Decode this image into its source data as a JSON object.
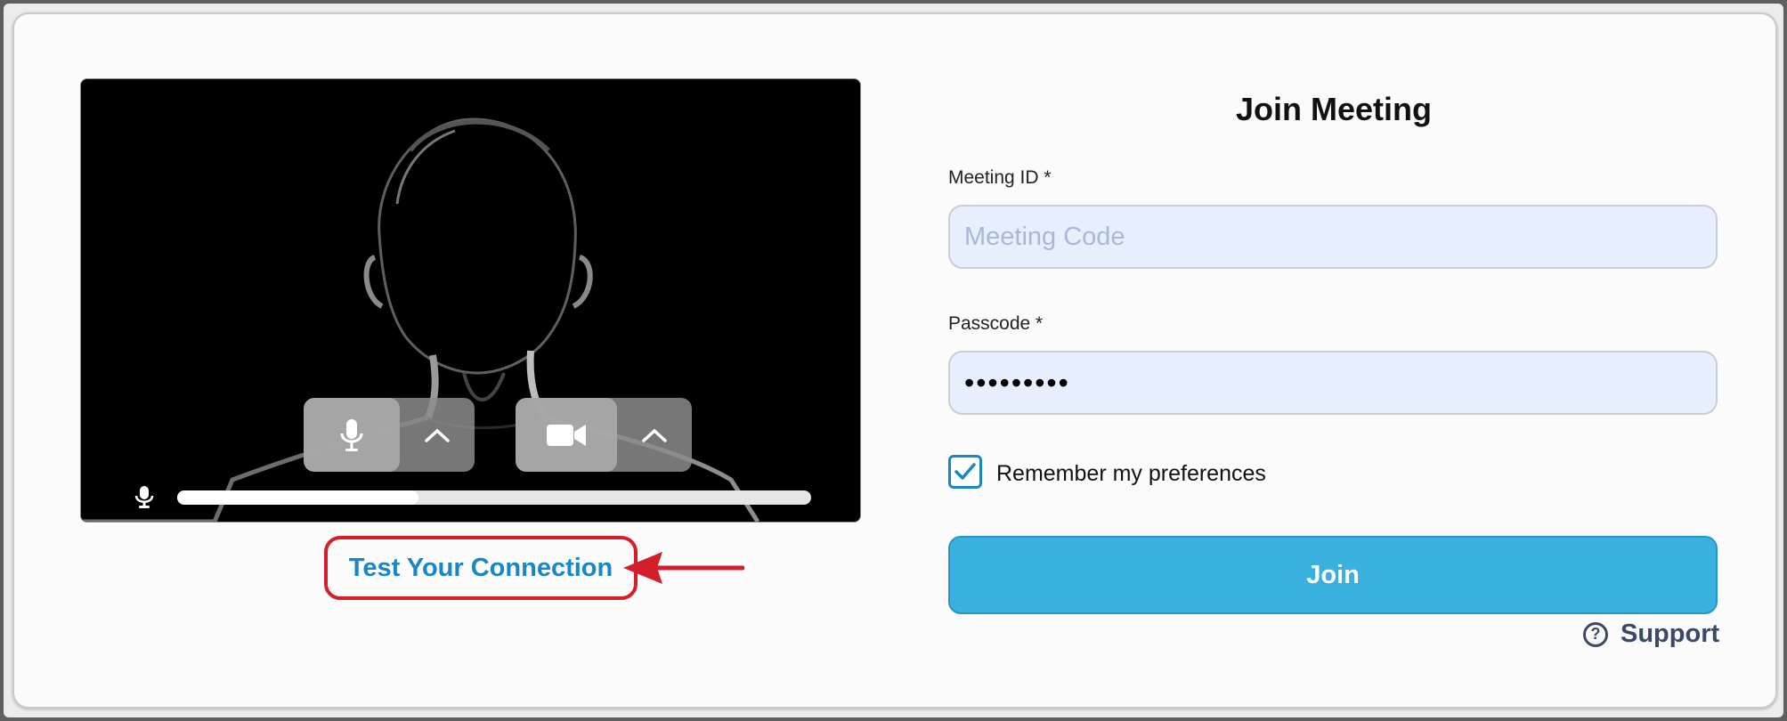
{
  "preview": {
    "mic_level": 0.38
  },
  "test_link": {
    "label": "Test Your Connection"
  },
  "form": {
    "title": "Join Meeting",
    "meeting_id": {
      "label": "Meeting ID *",
      "placeholder": "Meeting Code",
      "value": ""
    },
    "passcode": {
      "label": "Passcode *",
      "value": "•••••••••"
    },
    "remember": {
      "label": "Remember my preferences",
      "checked": true
    },
    "join_label": "Join",
    "support_label": "Support"
  },
  "colors": {
    "accent": "#1a87c4",
    "join_button": "#3ab0e0",
    "annotation": "#d41f2b"
  }
}
